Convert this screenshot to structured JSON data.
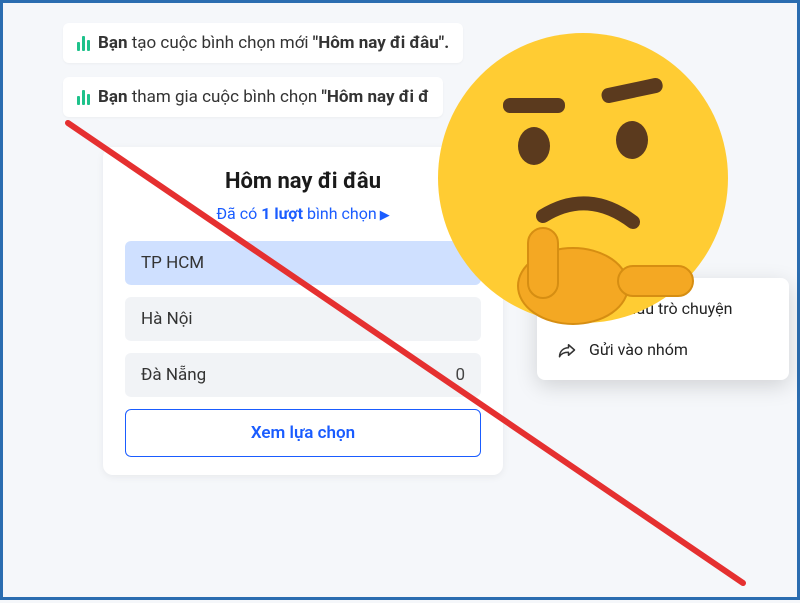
{
  "messages": {
    "created": {
      "prefix": "Bạn",
      "mid": " tạo cuộc bình chọn mới ",
      "quote": "\"Hôm nay đi đâu\"."
    },
    "joined": {
      "prefix": "Bạn",
      "mid": " tham gia cuộc bình chọn ",
      "quote": "\"Hôm nay đi đ"
    }
  },
  "poll": {
    "title": "Hôm nay đi đâu",
    "sub_prefix": "Đã có ",
    "sub_count": "1 lượt",
    "sub_suffix": " bình chọn",
    "options": [
      {
        "label": "TP HCM",
        "count": "",
        "selected": true
      },
      {
        "label": "Hà Nội",
        "count": "",
        "selected": false
      },
      {
        "label": "Đà Nẵng",
        "count": "0",
        "selected": false
      }
    ],
    "view_btn": "Xem lựa chọn"
  },
  "menu": {
    "pin": "n lên đầu trò chuyện",
    "share": "Gửi vào nhóm"
  }
}
